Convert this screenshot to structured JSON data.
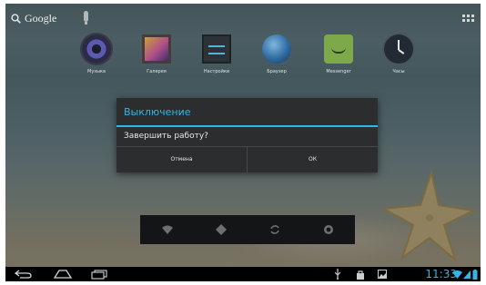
{
  "search": {
    "label": "Google"
  },
  "apps": [
    {
      "label": "Музыка",
      "icon": "music-icon"
    },
    {
      "label": "Галерея",
      "icon": "gallery-icon"
    },
    {
      "label": "Настройки",
      "icon": "settings-icon"
    },
    {
      "label": "Браузер",
      "icon": "browser-icon"
    },
    {
      "label": "Messenger",
      "icon": "messenger-icon"
    },
    {
      "label": "Часы",
      "icon": "clock-icon"
    }
  ],
  "dialog": {
    "title": "Выключение",
    "message": "Завершить работу?",
    "cancel_label": "Отмена",
    "ok_label": "ОК"
  },
  "quick_toggles": [
    "wifi-icon",
    "gps-icon",
    "sync-icon",
    "brightness-icon"
  ],
  "status": {
    "time": "11:33"
  },
  "colors": {
    "accent": "#33b5e5",
    "dialog_bg": "#2b2d2f"
  }
}
